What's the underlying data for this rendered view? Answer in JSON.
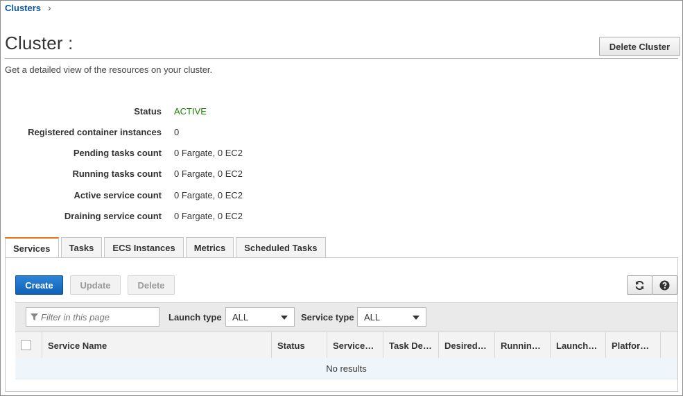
{
  "breadcrumb": {
    "link": "Clusters",
    "separator": "›"
  },
  "header": {
    "title": "Cluster :",
    "subtitle": "Get a detailed view of the resources on your cluster.",
    "delete_cluster_label": "Delete Cluster"
  },
  "summary": {
    "status": {
      "label": "Status",
      "value": "ACTIVE",
      "color": "#1d8102"
    },
    "registered": {
      "label": "Registered container instances",
      "value": "0"
    },
    "pending": {
      "label": "Pending tasks count",
      "value": "0 Fargate, 0 EC2"
    },
    "running": {
      "label": "Running tasks count",
      "value": "0 Fargate, 0 EC2"
    },
    "active_service": {
      "label": "Active service count",
      "value": "0 Fargate, 0 EC2"
    },
    "draining": {
      "label": "Draining service count",
      "value": "0 Fargate, 0 EC2"
    }
  },
  "tabs": [
    {
      "label": "Services",
      "active": true
    },
    {
      "label": "Tasks"
    },
    {
      "label": "ECS Instances"
    },
    {
      "label": "Metrics"
    },
    {
      "label": "Scheduled Tasks"
    }
  ],
  "toolbar": {
    "create_label": "Create",
    "update_label": "Update",
    "delete_label": "Delete",
    "refresh_icon": "refresh-icon",
    "help_icon": "help-icon"
  },
  "filters": {
    "search_placeholder": "Filter in this page",
    "launch_type_label": "Launch type",
    "launch_type_value": "ALL",
    "service_type_label": "Service type",
    "service_type_value": "ALL"
  },
  "table": {
    "columns": [
      "Service Name",
      "Status",
      "Service…",
      "Task De…",
      "Desired…",
      "Runnin…",
      "Launch…",
      "Platfor…"
    ],
    "empty_text": "No results"
  },
  "colors": {
    "accent_tab": "#ec7211",
    "primary_button": "#1a6fc4",
    "link": "#0b57a4"
  }
}
